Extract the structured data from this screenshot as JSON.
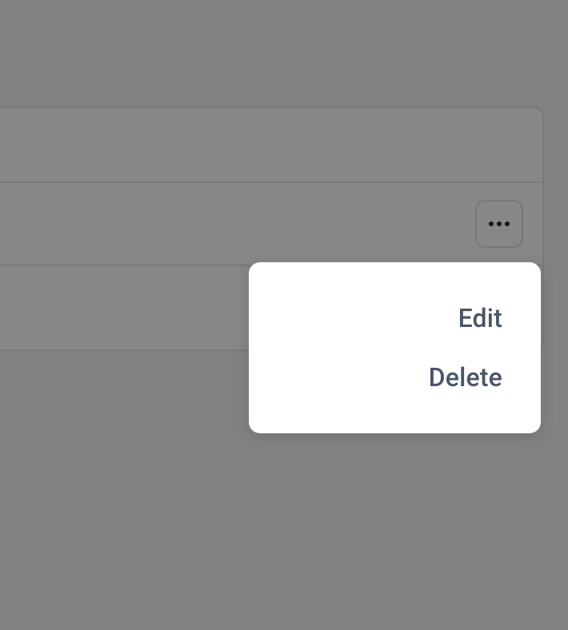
{
  "menu": {
    "edit_label": "Edit",
    "delete_label": "Delete"
  }
}
